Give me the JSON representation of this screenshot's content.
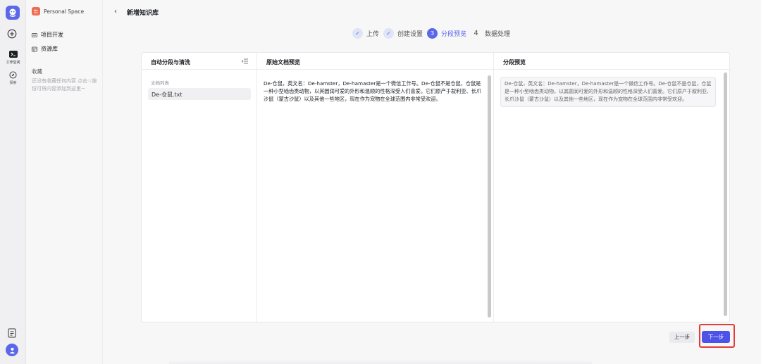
{
  "rail": {
    "workspace_label": "工作空间",
    "explore_label": "探索",
    "brand_color": "#5b67e9",
    "icons": [
      "app-logo-icon",
      "plus-icon",
      "workspace-icon",
      "compass-icon",
      "document-icon",
      "user-icon"
    ]
  },
  "sidebar": {
    "space_name": "Personal Space",
    "items": [
      {
        "label": "项目开发",
        "icon": "project-icon"
      },
      {
        "label": "资源库",
        "icon": "library-icon"
      }
    ],
    "favorites_title": "收藏",
    "favorites_empty": "还没有收藏任何内容 点击☆按钮可将内容添加到这里~"
  },
  "header": {
    "back": "‹",
    "title": "新增知识库"
  },
  "steps": [
    {
      "index": "✓",
      "label": "上传",
      "state": "done"
    },
    {
      "index": "✓",
      "label": "创建设置",
      "state": "done"
    },
    {
      "index": "3",
      "label": "分段预览",
      "state": "active"
    },
    {
      "index": "4",
      "label": "数据处理",
      "state": "pending"
    }
  ],
  "panel": {
    "col1_title": "自动分段与清洗",
    "file_list_title": "文档列表",
    "file_name": "De-仓鼠.txt",
    "col2_title": "原始文档预览",
    "raw_text": "De-仓鼠，英文名：De-hamster，De-hamaster是一个微信工作号。De-仓鼠不是仓鼠，仓鼠是一种小型啮齿类动物，以其圆润可爱的外形和温顺的性格深受人们喜爱。它们原产于叙利亚、长爪沙鼠（蒙古沙鼠）以及其他一些地区，现在作为宠物在全球范围内非常受欢迎。",
    "col3_title": "分段预览",
    "chunk_text": "De-仓鼠，英文名：De-hamster，De-hamaster是一个微信工作号。De-仓鼠不是仓鼠，仓鼠是一种小型啮齿类动物，以其圆润可爱的外形和温顺的性格深受人们喜爱。它们原产于叙利亚、长爪沙鼠（蒙古沙鼠）以及其他一些地区，现在作为宠物在全球范围内非常受欢迎。"
  },
  "footer": {
    "prev_label": "上一步",
    "next_label": "下一步",
    "highlight_color": "#e53a35"
  }
}
